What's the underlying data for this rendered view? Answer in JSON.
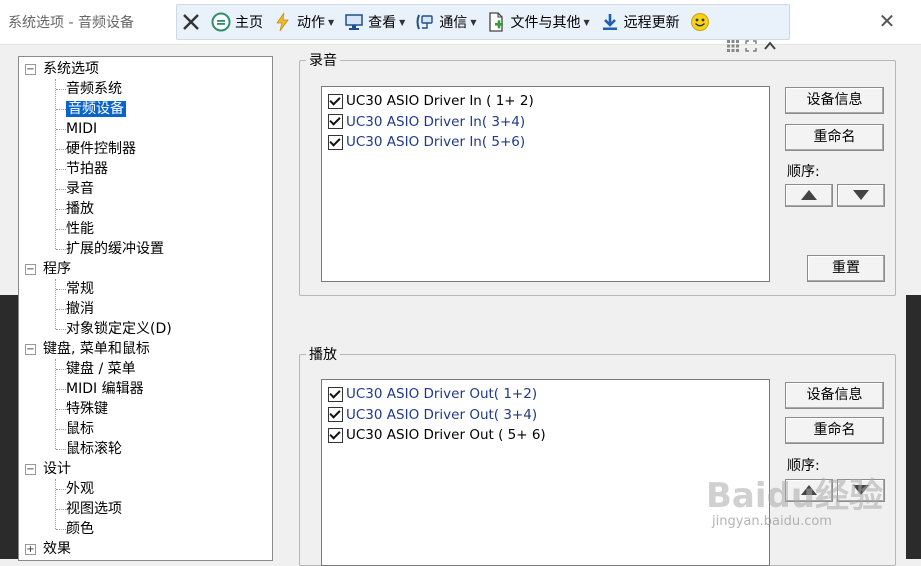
{
  "window": {
    "title": "系统选项 - 音频设备"
  },
  "toolbar": {
    "items": [
      {
        "label": "主页",
        "icon": "home-icon",
        "dropdown": false
      },
      {
        "label": "动作",
        "icon": "lightning-icon",
        "dropdown": true
      },
      {
        "label": "查看",
        "icon": "monitor-icon",
        "dropdown": true
      },
      {
        "label": "通信",
        "icon": "connection-icon",
        "dropdown": true
      },
      {
        "label": "文件与其他",
        "icon": "file-icon",
        "dropdown": true
      },
      {
        "label": "远程更新",
        "icon": "download-icon",
        "dropdown": false
      }
    ]
  },
  "tree": {
    "groups": [
      {
        "label": "系统选项",
        "expanded": true,
        "children": [
          "音频系统",
          "音频设备",
          "MIDI",
          "硬件控制器",
          "节拍器",
          "录音",
          "播放",
          "性能",
          "扩展的缓冲设置"
        ]
      },
      {
        "label": "程序",
        "expanded": true,
        "children": [
          "常规",
          "撤消",
          "对象锁定定义(D)"
        ]
      },
      {
        "label": "键盘, 菜单和鼠标",
        "expanded": true,
        "children": [
          "键盘 / 菜单",
          "MIDI 编辑器",
          "特殊键",
          "鼠标",
          "鼠标滚轮"
        ]
      },
      {
        "label": "设计",
        "expanded": true,
        "children": [
          "外观",
          "视图选项",
          "颜色"
        ]
      },
      {
        "label": "效果",
        "expanded": false,
        "children": []
      }
    ],
    "selected": "音频设备"
  },
  "recording": {
    "group_label": "录音",
    "devices": [
      {
        "name": "UC30 ASIO Driver In ( 1+ 2)",
        "checked": true,
        "color": "#000000"
      },
      {
        "name": "UC30 ASIO Driver In( 3+4)",
        "checked": true,
        "color": "#1f3a8a"
      },
      {
        "name": "UC30 ASIO Driver In( 5+6)",
        "checked": true,
        "color": "#1f3a8a"
      }
    ],
    "device_info_button": "设备信息",
    "rename_button": "重命名",
    "order_label": "顺序:",
    "reset_button": "重置"
  },
  "playback": {
    "group_label": "播放",
    "devices": [
      {
        "name": "UC30 ASIO Driver Out( 1+2)",
        "checked": true,
        "color": "#1f3a8a"
      },
      {
        "name": "UC30 ASIO Driver Out( 3+4)",
        "checked": true,
        "color": "#1f3a8a"
      },
      {
        "name": "UC30 ASIO Driver Out ( 5+ 6)",
        "checked": true,
        "color": "#000000"
      }
    ],
    "device_info_button": "设备信息",
    "rename_button": "重命名",
    "order_label": "顺序:"
  },
  "watermark": {
    "brand": "Baidu经验",
    "url": "jingyan.baidu.com"
  }
}
